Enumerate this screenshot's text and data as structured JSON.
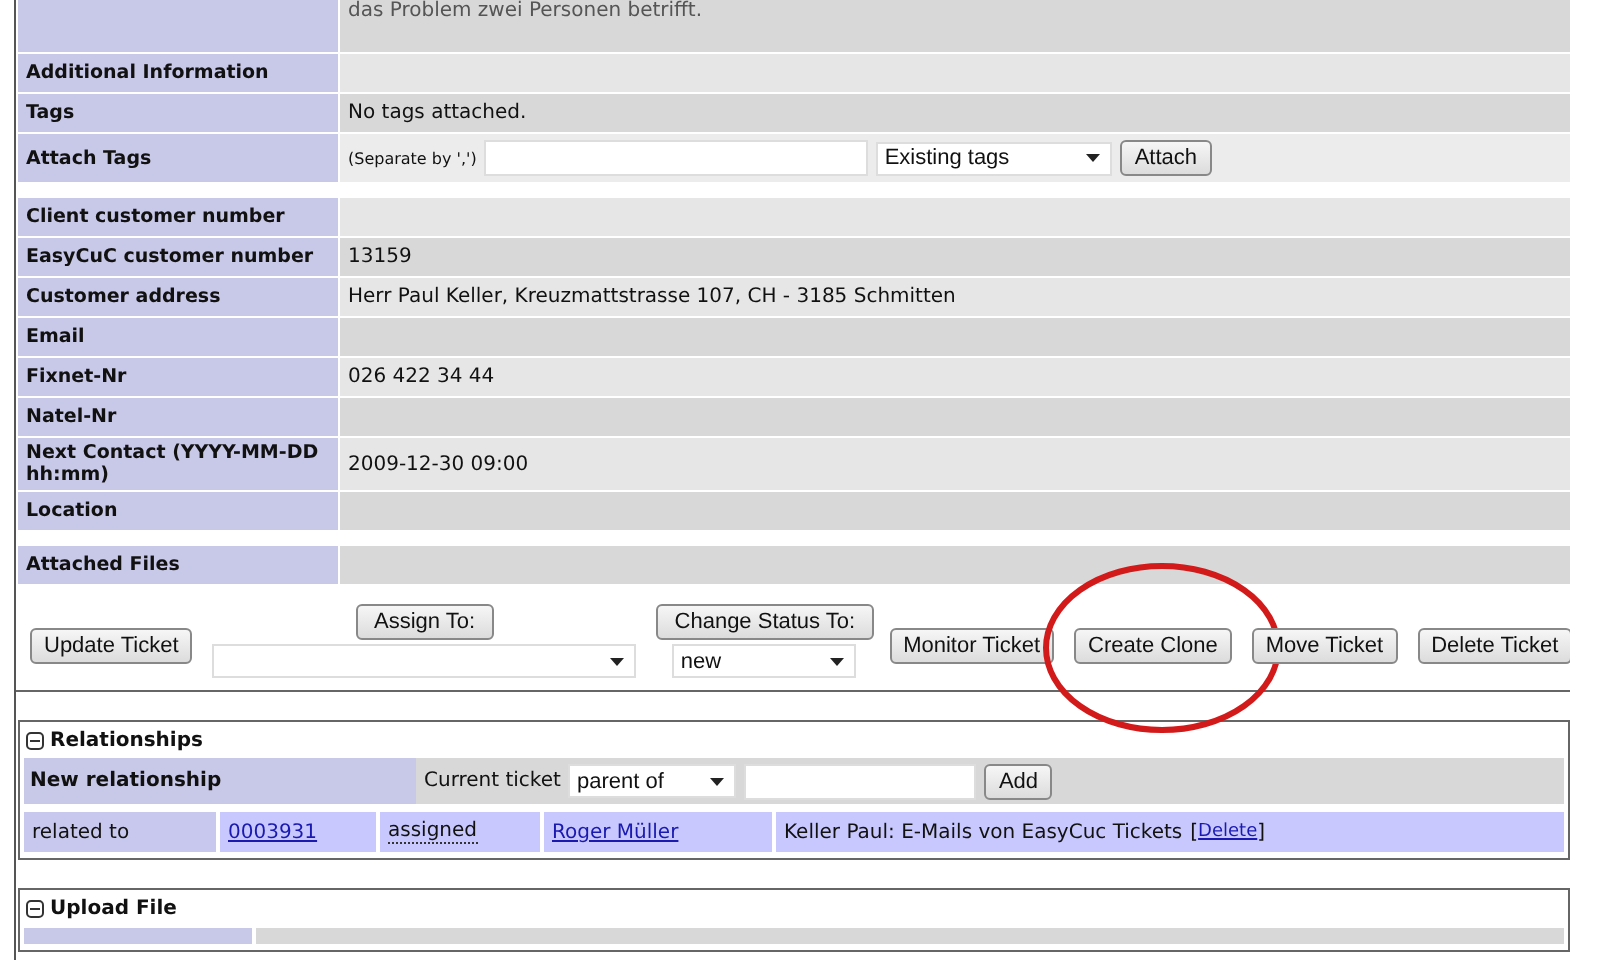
{
  "fields": [
    {
      "kind": "text",
      "value": "das Problem zwei Personen betrifft."
    },
    {
      "kind": "text",
      "label": "Additional Information"
    },
    {
      "kind": "text",
      "label": "Tags",
      "value": "No tags attached."
    },
    {
      "kind": "tags",
      "label": "Attach Tags",
      "hint": "(Separate by ',')",
      "select": "Existing tags",
      "button": "Attach"
    },
    {
      "kind": "spacer"
    },
    {
      "kind": "text",
      "label": "Client customer number"
    },
    {
      "kind": "text",
      "label": "EasyCuC customer number",
      "value": "13159"
    },
    {
      "kind": "text",
      "label": "Customer address",
      "value": "Herr Paul Keller, Kreuzmattstrasse 107, CH - 3185 Schmitten"
    },
    {
      "kind": "text",
      "label": "Email"
    },
    {
      "kind": "text",
      "label": "Fixnet-Nr",
      "value": "026 422 34 44"
    },
    {
      "kind": "text",
      "label": "Natel-Nr"
    },
    {
      "kind": "text",
      "label": "Next Contact (YYYY-MM-DD hh:mm)",
      "value": "2009-12-30 09:00"
    },
    {
      "kind": "text",
      "label": "Location"
    },
    {
      "kind": "spacer"
    },
    {
      "kind": "text",
      "label": "Attached Files"
    }
  ],
  "actions": [
    {
      "kind": "button",
      "label": "Update Ticket"
    },
    {
      "kind": "button_select",
      "label": "Assign To:"
    },
    {
      "kind": "button_select",
      "label": "Change Status To:",
      "select": "new"
    },
    {
      "kind": "button",
      "label": "Monitor Ticket"
    },
    {
      "kind": "button",
      "label": "Create Clone",
      "circled": true
    },
    {
      "kind": "button",
      "label": "Move Ticket"
    },
    {
      "kind": "button",
      "label": "Delete Ticket"
    }
  ],
  "relationships": {
    "title": "Relationships",
    "expanded": true,
    "new_label": "New relationship",
    "current_label": "Current ticket",
    "select": "parent of",
    "button": "Add",
    "rows": [
      {
        "type": "related to",
        "ticket": "0003931",
        "status": "assigned",
        "handler": "Roger Müller",
        "summary": "Keller Paul: E-Mails von EasyCuc Tickets",
        "delete_prefix": "[",
        "delete": "Delete",
        "delete_suffix": "]"
      }
    ]
  },
  "upload": {
    "title": "Upload File",
    "expanded": true
  }
}
